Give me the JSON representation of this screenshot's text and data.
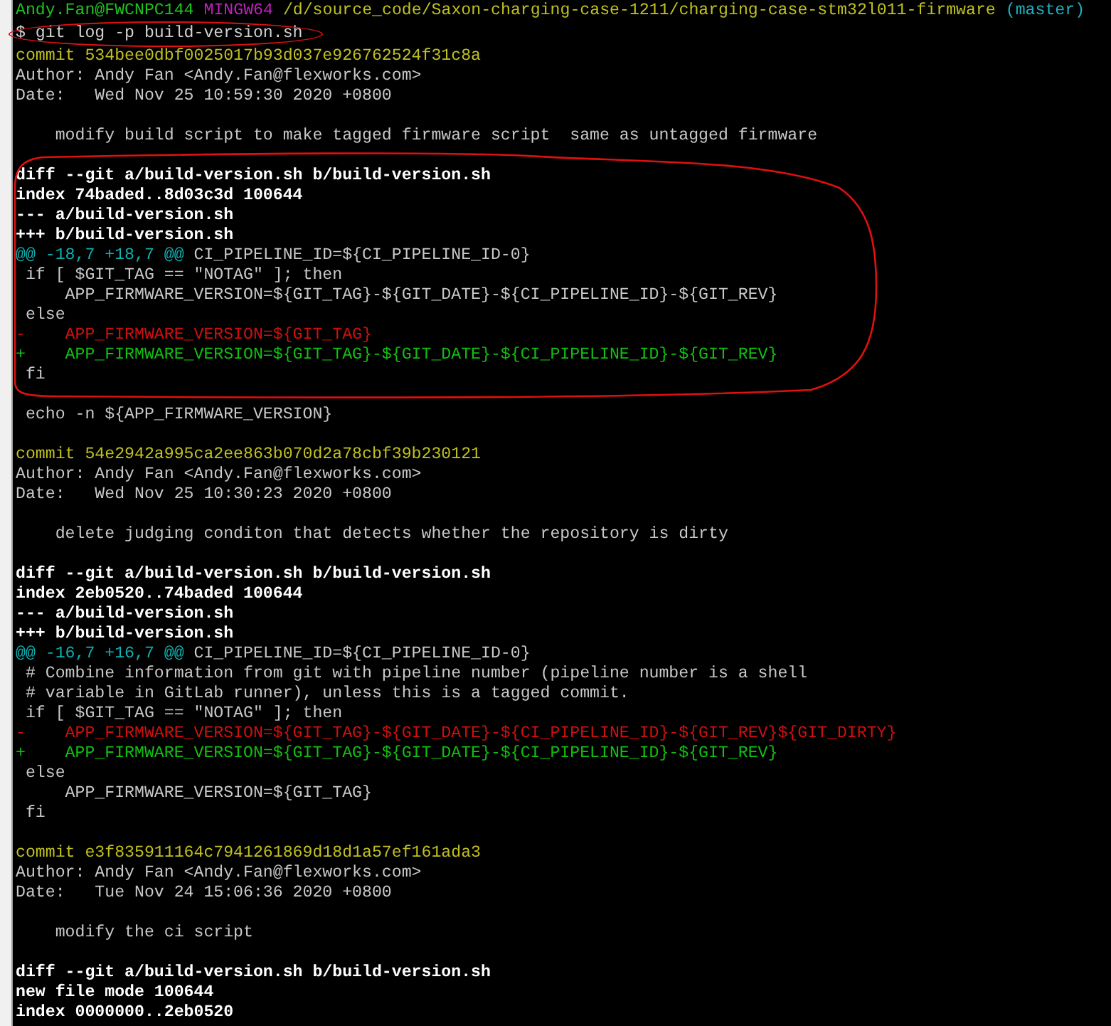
{
  "terminal": {
    "lines": [
      {
        "kind": "prompt",
        "segments": [
          {
            "text": "Andy.Fan@FWCNPC144",
            "color": "#1ec21e"
          },
          {
            "text": "MINGW64",
            "color": "#c020c0"
          },
          {
            "text": "/d/source_code/Saxon-charging-case-1211/charging-case-stm32l011-firmware",
            "color": "#c0c020"
          },
          {
            "text": "(master)",
            "color": "#20b0c0"
          }
        ]
      },
      {
        "kind": "command",
        "text": "$ git log -p build-version.sh",
        "circled": true
      },
      {
        "kind": "commit",
        "text": "commit 534bee0dbf0025017b93d037e926762524f31c8a"
      },
      {
        "kind": "plain",
        "text": "Author: Andy Fan <Andy.Fan@flexworks.com>"
      },
      {
        "kind": "plain",
        "text": "Date:   Wed Nov 25 10:59:30 2020 +0800"
      },
      {
        "kind": "blank"
      },
      {
        "kind": "plain",
        "text": "    modify build script to make tagged firmware script  same as untagged firmware"
      },
      {
        "kind": "blank"
      },
      {
        "kind": "header",
        "text": "diff --git a/build-version.sh b/build-version.sh"
      },
      {
        "kind": "header",
        "text": "index 74baded..8d03c3d 100644"
      },
      {
        "kind": "header",
        "text": "--- a/build-version.sh"
      },
      {
        "kind": "header",
        "text": "+++ b/build-version.sh"
      },
      {
        "kind": "hunk",
        "range": "@@ -18,7 +18,7 @@",
        "context": " CI_PIPELINE_ID=${CI_PIPELINE_ID-0}"
      },
      {
        "kind": "plain",
        "text": " if [ $GIT_TAG == \"NOTAG\" ]; then"
      },
      {
        "kind": "plain",
        "text": "     APP_FIRMWARE_VERSION=${GIT_TAG}-${GIT_DATE}-${CI_PIPELINE_ID}-${GIT_REV}"
      },
      {
        "kind": "plain",
        "text": " else"
      },
      {
        "kind": "removed",
        "text": "-    APP_FIRMWARE_VERSION=${GIT_TAG}"
      },
      {
        "kind": "added",
        "text": "+    APP_FIRMWARE_VERSION=${GIT_TAG}-${GIT_DATE}-${CI_PIPELINE_ID}-${GIT_REV}"
      },
      {
        "kind": "plain",
        "text": " fi"
      },
      {
        "kind": "blank"
      },
      {
        "kind": "plain",
        "text": " echo -n ${APP_FIRMWARE_VERSION}"
      },
      {
        "kind": "blank"
      },
      {
        "kind": "commit",
        "text": "commit 54e2942a995ca2ee863b070d2a78cbf39b230121"
      },
      {
        "kind": "plain",
        "text": "Author: Andy Fan <Andy.Fan@flexworks.com>"
      },
      {
        "kind": "plain",
        "text": "Date:   Wed Nov 25 10:30:23 2020 +0800"
      },
      {
        "kind": "blank"
      },
      {
        "kind": "plain",
        "text": "    delete judging conditon that detects whether the repository is dirty"
      },
      {
        "kind": "blank"
      },
      {
        "kind": "header",
        "text": "diff --git a/build-version.sh b/build-version.sh"
      },
      {
        "kind": "header",
        "text": "index 2eb0520..74baded 100644"
      },
      {
        "kind": "header",
        "text": "--- a/build-version.sh"
      },
      {
        "kind": "header",
        "text": "+++ b/build-version.sh"
      },
      {
        "kind": "hunk",
        "range": "@@ -16,7 +16,7 @@",
        "context": " CI_PIPELINE_ID=${CI_PIPELINE_ID-0}"
      },
      {
        "kind": "plain",
        "text": " # Combine information from git with pipeline number (pipeline number is a shell"
      },
      {
        "kind": "plain",
        "text": " # variable in GitLab runner), unless this is a tagged commit."
      },
      {
        "kind": "plain",
        "text": " if [ $GIT_TAG == \"NOTAG\" ]; then"
      },
      {
        "kind": "removed",
        "text": "-    APP_FIRMWARE_VERSION=${GIT_TAG}-${GIT_DATE}-${CI_PIPELINE_ID}-${GIT_REV}${GIT_DIRTY}"
      },
      {
        "kind": "added",
        "text": "+    APP_FIRMWARE_VERSION=${GIT_TAG}-${GIT_DATE}-${CI_PIPELINE_ID}-${GIT_REV}"
      },
      {
        "kind": "plain",
        "text": " else"
      },
      {
        "kind": "plain",
        "text": "     APP_FIRMWARE_VERSION=${GIT_TAG}"
      },
      {
        "kind": "plain",
        "text": " fi"
      },
      {
        "kind": "blank"
      },
      {
        "kind": "commit",
        "text": "commit e3f835911164c7941261869d18d1a57ef161ada3"
      },
      {
        "kind": "plain",
        "text": "Author: Andy Fan <Andy.Fan@flexworks.com>"
      },
      {
        "kind": "plain",
        "text": "Date:   Tue Nov 24 15:06:36 2020 +0800"
      },
      {
        "kind": "blank"
      },
      {
        "kind": "plain",
        "text": "    modify the ci script"
      },
      {
        "kind": "blank"
      },
      {
        "kind": "header",
        "text": "diff --git a/build-version.sh b/build-version.sh"
      },
      {
        "kind": "header",
        "text": "new file mode 100644"
      },
      {
        "kind": "header",
        "text": "index 0000000..2eb0520"
      }
    ]
  }
}
